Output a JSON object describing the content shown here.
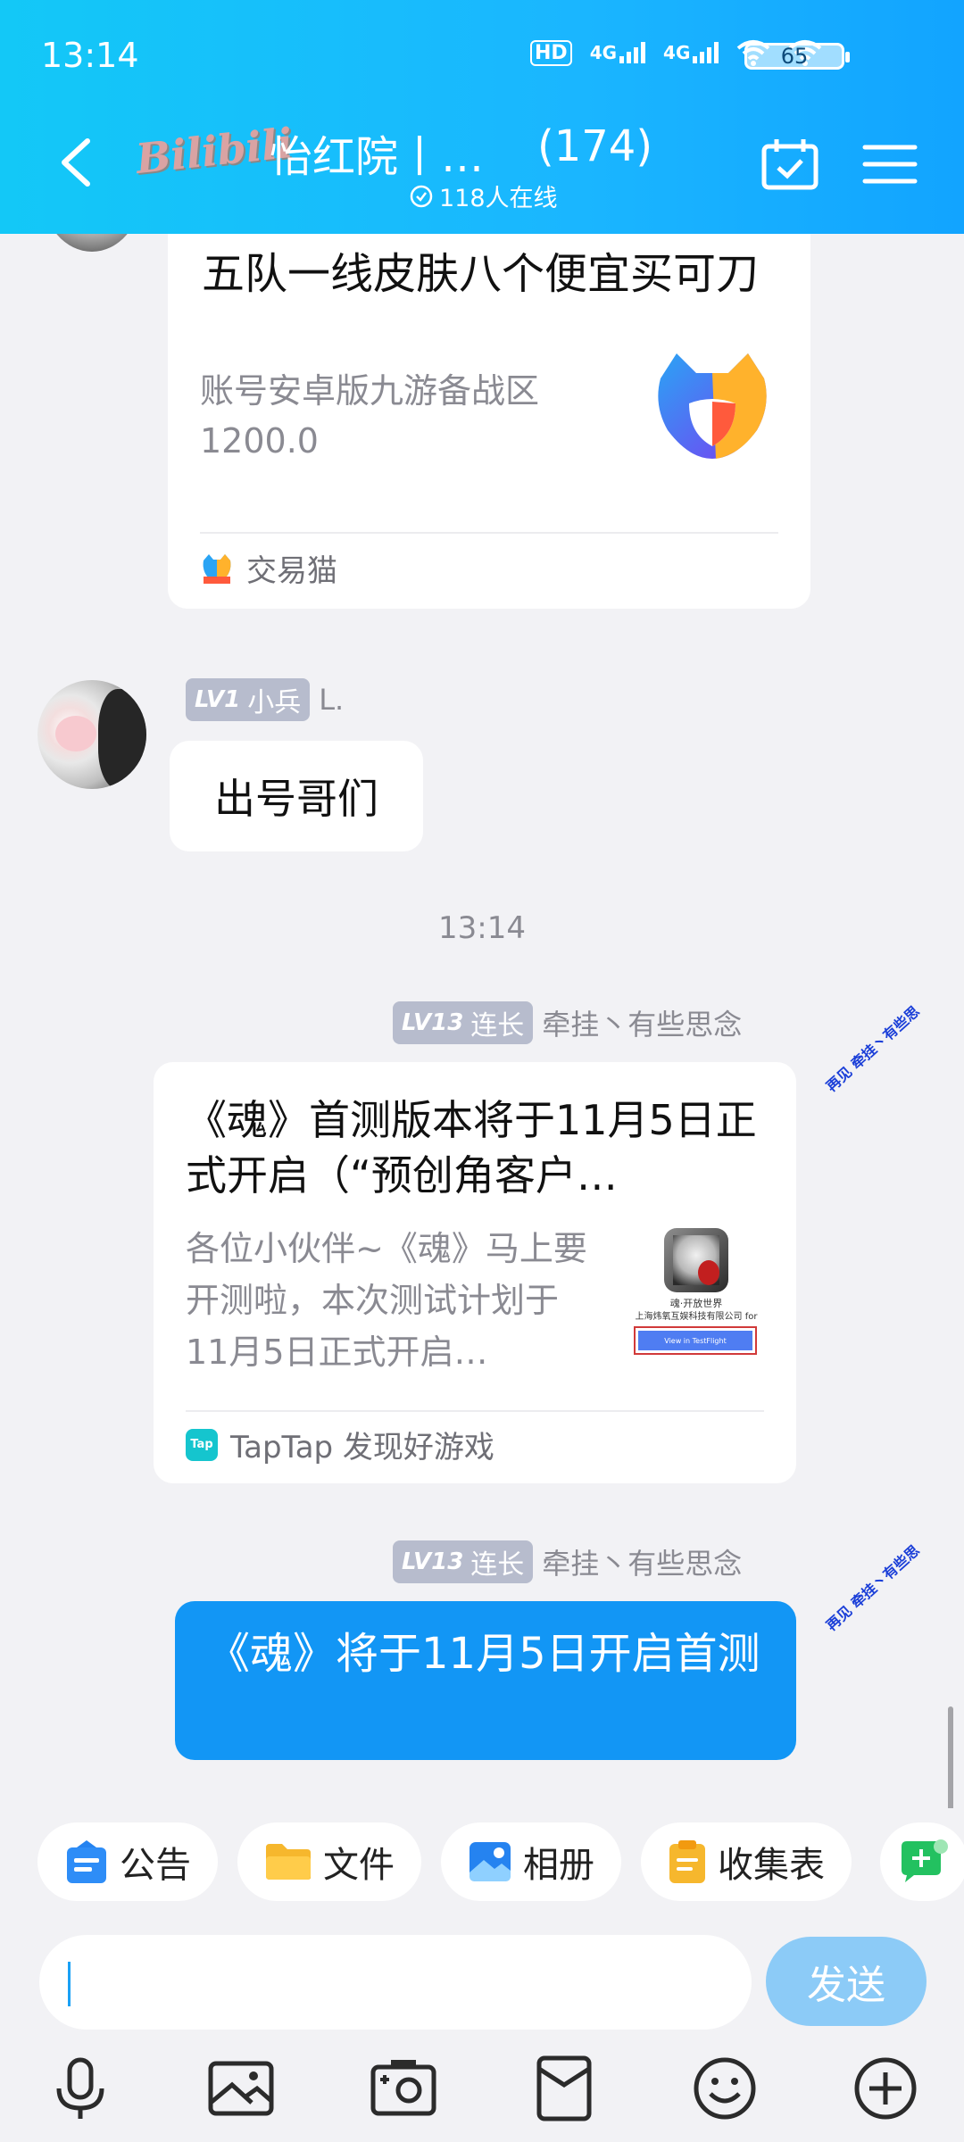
{
  "status_bar": {
    "time": "13:14",
    "battery": "65",
    "hd": "HD",
    "net1": "4G",
    "net2": "4G"
  },
  "header": {
    "group_logo_text": "Bilibili",
    "group_title": "怡红院丨…",
    "member_count": "(174)",
    "online_text": "118人在线"
  },
  "messages": {
    "msg1": {
      "title": "五队一线皮肤八个便宜买可刀",
      "desc": "账号安卓版九游备战区",
      "price": "1200.0",
      "source": "交易猫"
    },
    "msg2": {
      "level": "LV1",
      "rank": "小兵",
      "sender": "L.",
      "text": "出号哥们"
    },
    "timestamp": "13:14",
    "msg3": {
      "level": "LV13",
      "rank": "连长",
      "sender": "牵挂丶有些思念",
      "title": "《魂》首测版本将于11月5日正式开启（“预创角客户…",
      "desc": "各位小伙伴~《魂》马上要开测啦，本次测试计划于11月5日正式开启…",
      "thumb_caption1": "魂·开放世界",
      "thumb_caption2": "上海炜氧互娱科技有限公司 for",
      "thumb_button": "View in TestFlight",
      "source": "TapTap 发现好游戏",
      "source_icon": "Tap",
      "signature": "再见 牵挂丶有些思"
    },
    "msg4": {
      "level": "LV13",
      "rank": "连长",
      "sender": "牵挂丶有些思念",
      "text": "《魂》将于11月5日开启首测",
      "signature": "再见 牵挂丶有些思"
    }
  },
  "quick_actions": [
    {
      "label": "公告"
    },
    {
      "label": "文件"
    },
    {
      "label": "相册"
    },
    {
      "label": "收集表"
    }
  ],
  "input": {
    "value": "",
    "send_label": "发送"
  },
  "colors": {
    "header": "#1ab6ff",
    "send_button": "#8ccbf7",
    "outgoing_bubble": "#1296f5",
    "badge": "#b7bccd"
  }
}
